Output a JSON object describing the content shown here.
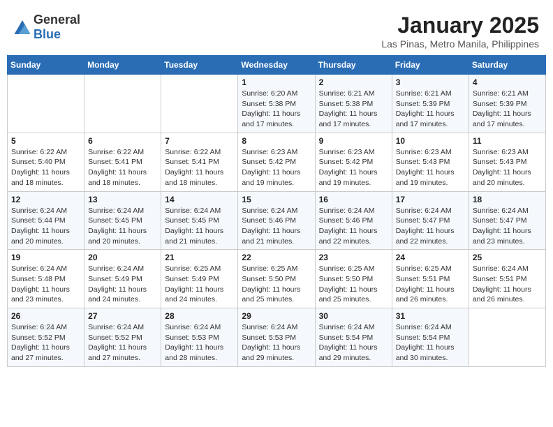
{
  "header": {
    "logo_general": "General",
    "logo_blue": "Blue",
    "month_title": "January 2025",
    "subtitle": "Las Pinas, Metro Manila, Philippines"
  },
  "weekdays": [
    "Sunday",
    "Monday",
    "Tuesday",
    "Wednesday",
    "Thursday",
    "Friday",
    "Saturday"
  ],
  "weeks": [
    [
      {
        "day": "",
        "sunrise": "",
        "sunset": "",
        "daylight": ""
      },
      {
        "day": "",
        "sunrise": "",
        "sunset": "",
        "daylight": ""
      },
      {
        "day": "",
        "sunrise": "",
        "sunset": "",
        "daylight": ""
      },
      {
        "day": "1",
        "sunrise": "Sunrise: 6:20 AM",
        "sunset": "Sunset: 5:38 PM",
        "daylight": "Daylight: 11 hours and 17 minutes."
      },
      {
        "day": "2",
        "sunrise": "Sunrise: 6:21 AM",
        "sunset": "Sunset: 5:38 PM",
        "daylight": "Daylight: 11 hours and 17 minutes."
      },
      {
        "day": "3",
        "sunrise": "Sunrise: 6:21 AM",
        "sunset": "Sunset: 5:39 PM",
        "daylight": "Daylight: 11 hours and 17 minutes."
      },
      {
        "day": "4",
        "sunrise": "Sunrise: 6:21 AM",
        "sunset": "Sunset: 5:39 PM",
        "daylight": "Daylight: 11 hours and 17 minutes."
      }
    ],
    [
      {
        "day": "5",
        "sunrise": "Sunrise: 6:22 AM",
        "sunset": "Sunset: 5:40 PM",
        "daylight": "Daylight: 11 hours and 18 minutes."
      },
      {
        "day": "6",
        "sunrise": "Sunrise: 6:22 AM",
        "sunset": "Sunset: 5:41 PM",
        "daylight": "Daylight: 11 hours and 18 minutes."
      },
      {
        "day": "7",
        "sunrise": "Sunrise: 6:22 AM",
        "sunset": "Sunset: 5:41 PM",
        "daylight": "Daylight: 11 hours and 18 minutes."
      },
      {
        "day": "8",
        "sunrise": "Sunrise: 6:23 AM",
        "sunset": "Sunset: 5:42 PM",
        "daylight": "Daylight: 11 hours and 19 minutes."
      },
      {
        "day": "9",
        "sunrise": "Sunrise: 6:23 AM",
        "sunset": "Sunset: 5:42 PM",
        "daylight": "Daylight: 11 hours and 19 minutes."
      },
      {
        "day": "10",
        "sunrise": "Sunrise: 6:23 AM",
        "sunset": "Sunset: 5:43 PM",
        "daylight": "Daylight: 11 hours and 19 minutes."
      },
      {
        "day": "11",
        "sunrise": "Sunrise: 6:23 AM",
        "sunset": "Sunset: 5:43 PM",
        "daylight": "Daylight: 11 hours and 20 minutes."
      }
    ],
    [
      {
        "day": "12",
        "sunrise": "Sunrise: 6:24 AM",
        "sunset": "Sunset: 5:44 PM",
        "daylight": "Daylight: 11 hours and 20 minutes."
      },
      {
        "day": "13",
        "sunrise": "Sunrise: 6:24 AM",
        "sunset": "Sunset: 5:45 PM",
        "daylight": "Daylight: 11 hours and 20 minutes."
      },
      {
        "day": "14",
        "sunrise": "Sunrise: 6:24 AM",
        "sunset": "Sunset: 5:45 PM",
        "daylight": "Daylight: 11 hours and 21 minutes."
      },
      {
        "day": "15",
        "sunrise": "Sunrise: 6:24 AM",
        "sunset": "Sunset: 5:46 PM",
        "daylight": "Daylight: 11 hours and 21 minutes."
      },
      {
        "day": "16",
        "sunrise": "Sunrise: 6:24 AM",
        "sunset": "Sunset: 5:46 PM",
        "daylight": "Daylight: 11 hours and 22 minutes."
      },
      {
        "day": "17",
        "sunrise": "Sunrise: 6:24 AM",
        "sunset": "Sunset: 5:47 PM",
        "daylight": "Daylight: 11 hours and 22 minutes."
      },
      {
        "day": "18",
        "sunrise": "Sunrise: 6:24 AM",
        "sunset": "Sunset: 5:47 PM",
        "daylight": "Daylight: 11 hours and 23 minutes."
      }
    ],
    [
      {
        "day": "19",
        "sunrise": "Sunrise: 6:24 AM",
        "sunset": "Sunset: 5:48 PM",
        "daylight": "Daylight: 11 hours and 23 minutes."
      },
      {
        "day": "20",
        "sunrise": "Sunrise: 6:24 AM",
        "sunset": "Sunset: 5:49 PM",
        "daylight": "Daylight: 11 hours and 24 minutes."
      },
      {
        "day": "21",
        "sunrise": "Sunrise: 6:25 AM",
        "sunset": "Sunset: 5:49 PM",
        "daylight": "Daylight: 11 hours and 24 minutes."
      },
      {
        "day": "22",
        "sunrise": "Sunrise: 6:25 AM",
        "sunset": "Sunset: 5:50 PM",
        "daylight": "Daylight: 11 hours and 25 minutes."
      },
      {
        "day": "23",
        "sunrise": "Sunrise: 6:25 AM",
        "sunset": "Sunset: 5:50 PM",
        "daylight": "Daylight: 11 hours and 25 minutes."
      },
      {
        "day": "24",
        "sunrise": "Sunrise: 6:25 AM",
        "sunset": "Sunset: 5:51 PM",
        "daylight": "Daylight: 11 hours and 26 minutes."
      },
      {
        "day": "25",
        "sunrise": "Sunrise: 6:24 AM",
        "sunset": "Sunset: 5:51 PM",
        "daylight": "Daylight: 11 hours and 26 minutes."
      }
    ],
    [
      {
        "day": "26",
        "sunrise": "Sunrise: 6:24 AM",
        "sunset": "Sunset: 5:52 PM",
        "daylight": "Daylight: 11 hours and 27 minutes."
      },
      {
        "day": "27",
        "sunrise": "Sunrise: 6:24 AM",
        "sunset": "Sunset: 5:52 PM",
        "daylight": "Daylight: 11 hours and 27 minutes."
      },
      {
        "day": "28",
        "sunrise": "Sunrise: 6:24 AM",
        "sunset": "Sunset: 5:53 PM",
        "daylight": "Daylight: 11 hours and 28 minutes."
      },
      {
        "day": "29",
        "sunrise": "Sunrise: 6:24 AM",
        "sunset": "Sunset: 5:53 PM",
        "daylight": "Daylight: 11 hours and 29 minutes."
      },
      {
        "day": "30",
        "sunrise": "Sunrise: 6:24 AM",
        "sunset": "Sunset: 5:54 PM",
        "daylight": "Daylight: 11 hours and 29 minutes."
      },
      {
        "day": "31",
        "sunrise": "Sunrise: 6:24 AM",
        "sunset": "Sunset: 5:54 PM",
        "daylight": "Daylight: 11 hours and 30 minutes."
      },
      {
        "day": "",
        "sunrise": "",
        "sunset": "",
        "daylight": ""
      }
    ]
  ]
}
